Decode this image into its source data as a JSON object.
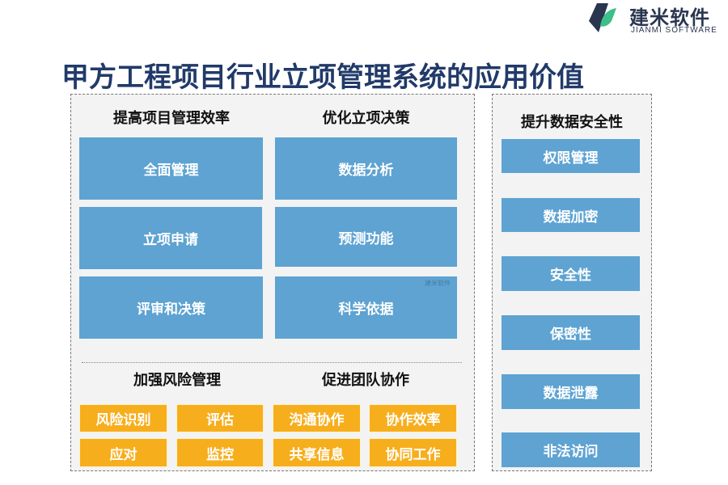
{
  "logo": {
    "name_cn": "建米软件",
    "name_en": "JIANMI SOFTWARE",
    "icon": "jianmi-logo-icon",
    "colors": {
      "dark": "#2a3550",
      "green": "#3dbf8a"
    }
  },
  "title": "甲方工程项目行业立项管理系统的应用价值",
  "colors": {
    "title": "#213a69",
    "blue_box": "#5ea3d2",
    "orange_box": "#f7ae1d",
    "panel_bg": "#f3f3f3"
  },
  "sections": {
    "efficiency": {
      "title": "提高项目管理效率",
      "items": [
        "全面管理",
        "立项申请",
        "评审和决策"
      ]
    },
    "decision": {
      "title": "优化立项决策",
      "items": [
        "数据分析",
        "预测功能",
        "科学依据"
      ]
    },
    "risk": {
      "title": "加强风险管理",
      "items": [
        "风险识别",
        "评估",
        "应对",
        "监控"
      ]
    },
    "team": {
      "title": "促进团队协作",
      "items": [
        "沟通协作",
        "协作效率",
        "共享信息",
        "协同工作"
      ]
    },
    "security": {
      "title": "提升数据安全性",
      "items": [
        "权限管理",
        "数据加密",
        "安全性",
        "保密性",
        "数据泄露",
        "非法访问"
      ]
    }
  },
  "watermark": "建米软件"
}
